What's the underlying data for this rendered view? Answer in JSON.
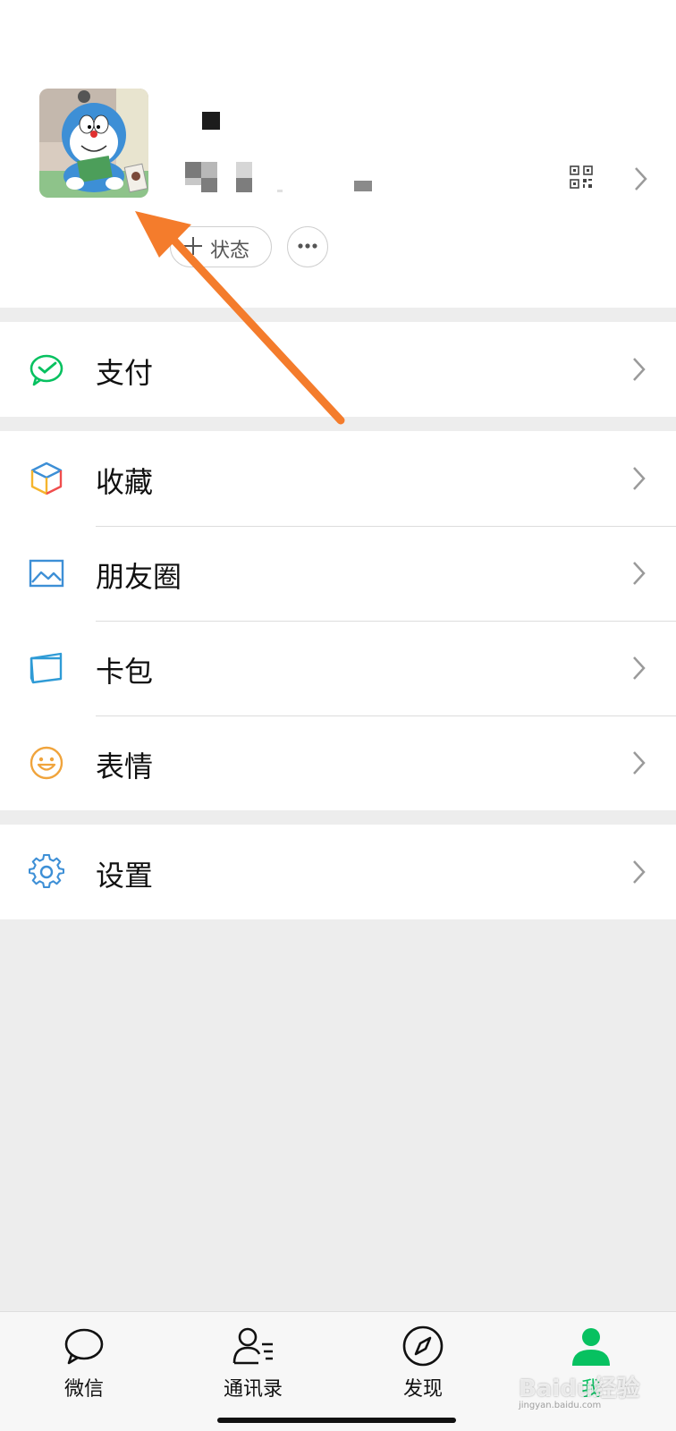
{
  "profile": {
    "status_label": "状态",
    "avatar_desc": "doraemon-avatar"
  },
  "menu": {
    "pay": {
      "label": "支付",
      "icon": "wechat-pay-icon"
    },
    "favorites": {
      "label": "收藏",
      "icon": "cube-icon"
    },
    "moments": {
      "label": "朋友圈",
      "icon": "image-icon"
    },
    "cards": {
      "label": "卡包",
      "icon": "card-wallet-icon"
    },
    "stickers": {
      "label": "表情",
      "icon": "smiley-icon"
    },
    "settings": {
      "label": "设置",
      "icon": "gear-icon"
    }
  },
  "tabbar": {
    "tabs": [
      {
        "label": "微信",
        "icon": "chat-bubble-icon",
        "active": false
      },
      {
        "label": "通讯录",
        "icon": "contacts-icon",
        "active": false
      },
      {
        "label": "发现",
        "icon": "compass-icon",
        "active": false
      },
      {
        "label": "我",
        "icon": "person-icon",
        "active": true
      }
    ]
  },
  "watermark": {
    "text": "Baidu经验",
    "sub": "jingyan.baidu.com"
  },
  "colors": {
    "accent": "#07c160",
    "annotation_arrow": "#f47c2c",
    "background": "#ededed"
  }
}
